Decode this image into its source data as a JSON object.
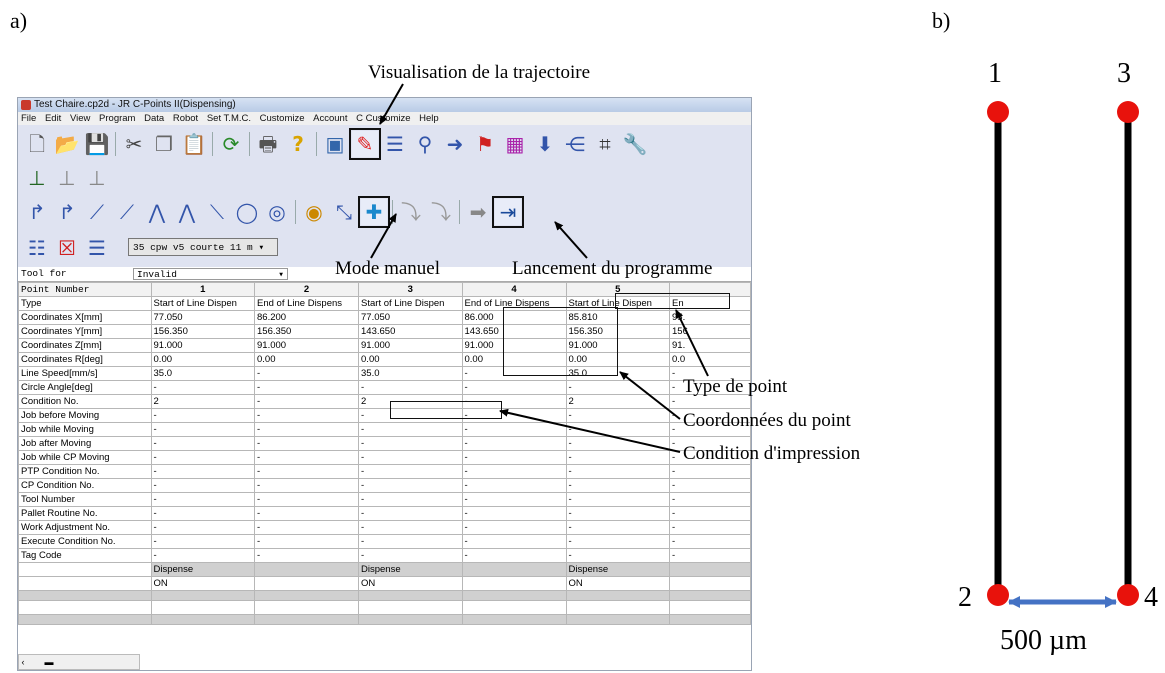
{
  "labels": {
    "a": "a)",
    "b": "b)"
  },
  "window": {
    "title": "Test Chaire.cp2d - JR C-Points II(Dispensing)",
    "menu": [
      "File",
      "Edit",
      "View",
      "Program",
      "Data",
      "Robot",
      "Set T.M.C.",
      "Customize",
      "Account",
      "C Customize",
      "Help"
    ],
    "combo_value": "35   cpw v5 courte 11 m",
    "tool_label": "Tool for",
    "tool_value": "Invalid"
  },
  "grid": {
    "header_label": "Point Number",
    "columns": [
      "1",
      "2",
      "3",
      "4",
      "5"
    ],
    "rows": [
      {
        "label": "Type",
        "cells": [
          "Start of Line Dispen",
          "End of Line Dispens",
          "Start of Line Dispen",
          "End of Line Dispens",
          "Start of Line Dispen"
        ]
      },
      {
        "label": "Coordinates X[mm]",
        "cells": [
          "77.050",
          "86.200",
          "77.050",
          "86.000",
          "85.810"
        ]
      },
      {
        "label": "Coordinates Y[mm]",
        "cells": [
          "156.350",
          "156.350",
          "143.650",
          "143.650",
          "156.350"
        ]
      },
      {
        "label": "Coordinates Z[mm]",
        "cells": [
          "91.000",
          "91.000",
          "91.000",
          "91.000",
          "91.000"
        ]
      },
      {
        "label": "Coordinates R[deg]",
        "cells": [
          "0.00",
          "0.00",
          "0.00",
          "0.00",
          "0.00"
        ]
      },
      {
        "label": "Line Speed[mm/s]",
        "cells": [
          "35.0",
          "-",
          "35.0",
          "-",
          "35.0"
        ]
      },
      {
        "label": "Circle Angle[deg]",
        "cells": [
          "-",
          "-",
          "-",
          "-",
          "-"
        ]
      },
      {
        "label": "Condition No.",
        "cells": [
          "2",
          "-",
          "2",
          "-",
          "2"
        ]
      },
      {
        "label": "Job before Moving",
        "cells": [
          "-",
          "-",
          "-",
          "-",
          "-"
        ]
      },
      {
        "label": "Job while Moving",
        "cells": [
          "-",
          "-",
          "-",
          "-",
          "-"
        ]
      },
      {
        "label": "Job after Moving",
        "cells": [
          "-",
          "-",
          "-",
          "-",
          "-"
        ]
      },
      {
        "label": "Job while CP Moving",
        "cells": [
          "-",
          "-",
          "-",
          "-",
          "-"
        ]
      },
      {
        "label": "PTP Condition No.",
        "cells": [
          "-",
          "-",
          "-",
          "-",
          "-"
        ]
      },
      {
        "label": "CP Condition No.",
        "cells": [
          "-",
          "-",
          "-",
          "-",
          "-"
        ]
      },
      {
        "label": "Tool Number",
        "cells": [
          "-",
          "-",
          "-",
          "-",
          "-"
        ]
      },
      {
        "label": "Pallet Routine No.",
        "cells": [
          "-",
          "-",
          "-",
          "-",
          "-"
        ]
      },
      {
        "label": "Work Adjustment No.",
        "cells": [
          "-",
          "-",
          "-",
          "-",
          "-"
        ]
      },
      {
        "label": "Execute Condition No.",
        "cells": [
          "-",
          "-",
          "-",
          "-",
          "-"
        ]
      },
      {
        "label": "Tag Code",
        "cells": [
          "-",
          "-",
          "-",
          "-",
          "-"
        ]
      }
    ],
    "dispense_row": [
      "Dispense",
      "",
      "Dispense",
      "",
      "Dispense"
    ],
    "on_row": [
      "ON",
      "",
      "ON",
      "",
      "ON"
    ],
    "overflow_col": [
      "En",
      "95.",
      "156",
      "91.",
      "0.0"
    ]
  },
  "annotations": {
    "visualisation": "Visualisation de la trajectoire",
    "mode_manuel": "Mode manuel",
    "lancement": "Lancement du programme",
    "type_point": "Type de point",
    "coordonnees": "Coordonnées du point",
    "condition": "Condition d'impression"
  },
  "diagram": {
    "points": [
      "1",
      "3",
      "2",
      "4"
    ],
    "scale": "500 µm",
    "point_color": "#e8120c",
    "arrow_color": "#4472c4"
  },
  "icons": {
    "toolbar_row1": [
      "new-file-icon",
      "open-folder-icon",
      "save-icon",
      "cut-icon",
      "copy-icon",
      "paste-icon",
      "refresh-icon",
      "print-icon",
      "help-icon",
      "view-icon",
      "visualisation-pen-icon",
      "list-icon",
      "tool-icon",
      "arrow-icon",
      "flag-icon",
      "grid-icon",
      "download-icon",
      "branch-icon",
      "cross-icon",
      "wrench-icon"
    ]
  }
}
